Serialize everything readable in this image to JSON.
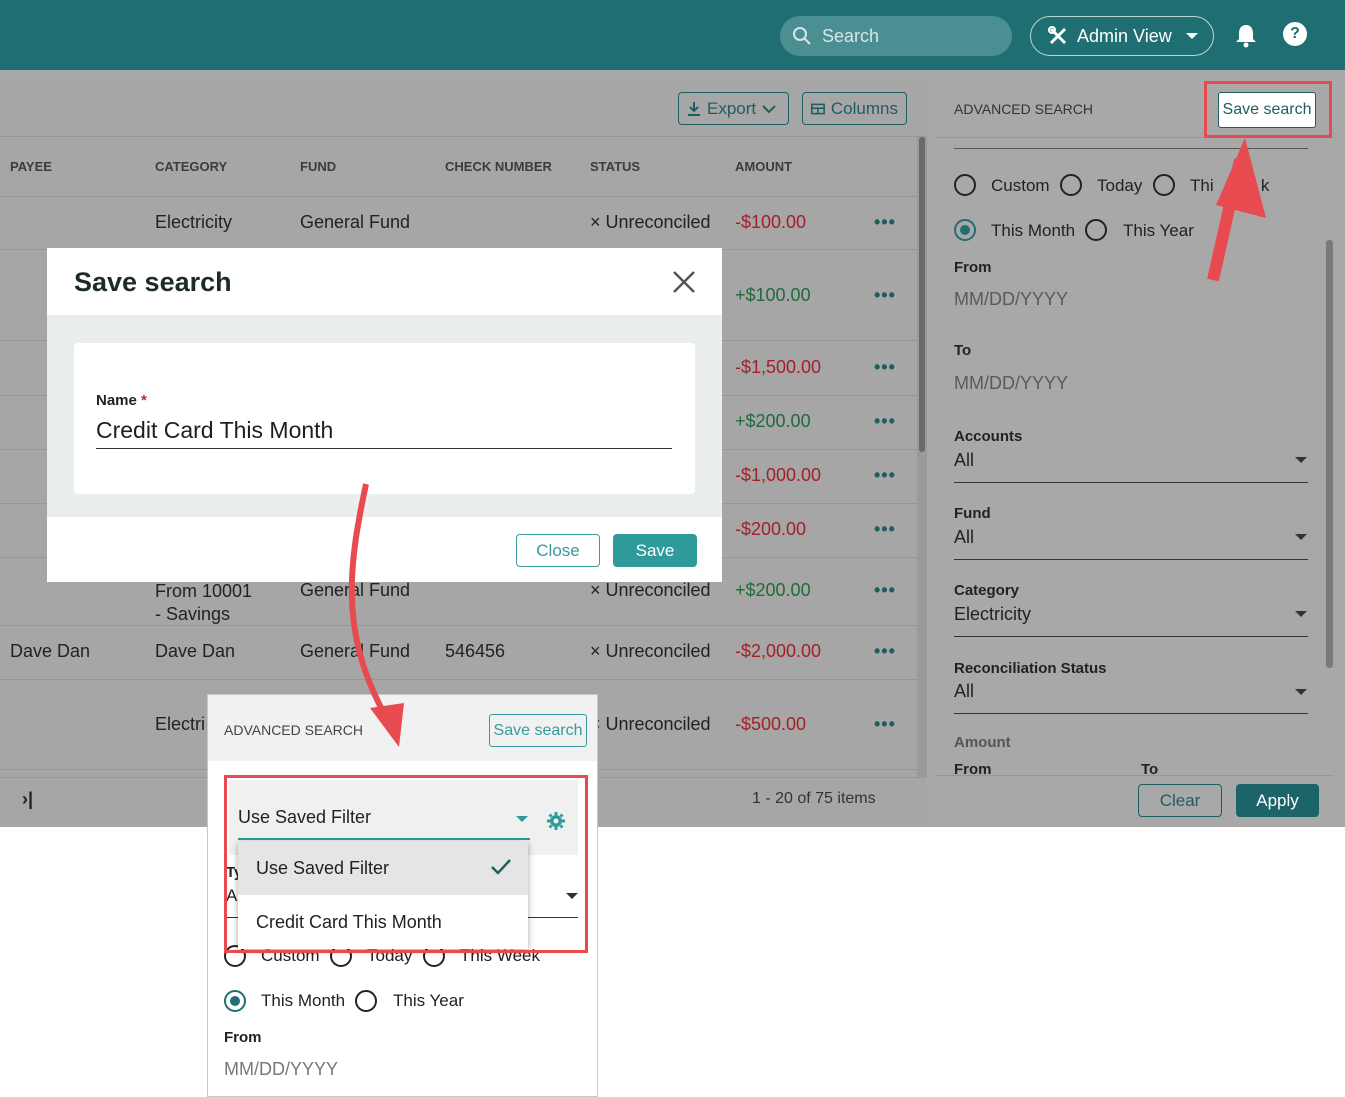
{
  "topbar": {
    "search_placeholder": "Search",
    "admin_label": "Admin View",
    "help_label": "?"
  },
  "toolbar": {
    "export_label": "Export",
    "columns_label": "Columns"
  },
  "table": {
    "headers": [
      "PAYEE",
      "CATEGORY",
      "FUND",
      "CHECK NUMBER",
      "STATUS",
      "AMOUNT"
    ],
    "rows": [
      {
        "payee": "",
        "category": "Electricity",
        "fund": "General Fund",
        "check": "",
        "status": "× Unreconciled",
        "amount": "-$100.00",
        "sign": "neg"
      },
      {
        "amount": "+$100.00",
        "sign": "pos"
      },
      {
        "amount": "-$1,500.00",
        "sign": "neg"
      },
      {
        "amount": "+$200.00",
        "sign": "pos"
      },
      {
        "amount": "-$1,000.00",
        "sign": "neg"
      },
      {
        "amount": "-$200.00",
        "sign": "neg"
      },
      {
        "payee": "",
        "category": "From 10001 - Savings",
        "category_line1": "From 10001",
        "category_line2": "- Savings",
        "fund": "General Fund",
        "check": "",
        "status": "× Unreconciled",
        "amount": "+$200.00",
        "sign": "pos"
      },
      {
        "payee": "Dave Dan",
        "category": "Dave Dan",
        "fund": "General Fund",
        "check": "546456",
        "status": "× Unreconciled",
        "amount": "-$2,000.00",
        "sign": "neg"
      },
      {
        "payee": "",
        "category": "Electri",
        "fund": "",
        "check": "",
        "status": "× Unreconciled",
        "amount": "-$500.00",
        "sign": "neg"
      }
    ],
    "row_action": "•••",
    "pager_last": "›|",
    "pager_info": "1 - 20 of 75 items"
  },
  "advanced_search": {
    "title": "ADVANCED SEARCH",
    "save_search_label": "Save search",
    "radio_options": [
      "Custom",
      "Today",
      "This Week",
      "This Month",
      "This Year"
    ],
    "radio_visible_partial": "Thi          k",
    "selected_period": "This Month",
    "from_label": "From",
    "from_placeholder": "MM/DD/YYYY",
    "to_label": "To",
    "to_placeholder": "MM/DD/YYYY",
    "accounts_label": "Accounts",
    "accounts_value": "All",
    "fund_label": "Fund",
    "fund_value": "All",
    "category_label": "Category",
    "category_value": "Electricity",
    "reconciliation_label": "Reconciliation Status",
    "reconciliation_value": "All",
    "amount_label": "Amount",
    "amount_from_label": "From",
    "amount_to_label": "To",
    "clear_label": "Clear",
    "apply_label": "Apply"
  },
  "modal": {
    "title": "Save search",
    "name_label": "Name",
    "required_mark": "*",
    "name_value": "Credit Card This Month",
    "close_label": "Close",
    "save_label": "Save"
  },
  "inset": {
    "title": "ADVANCED SEARCH",
    "save_search_label": "Save search",
    "saved_filter_value": "Use Saved Filter",
    "dropdown_options": [
      "Use Saved Filter",
      "Credit Card This Month"
    ],
    "selected_option": "Use Saved Filter",
    "type_partial": "Ty",
    "type_value_partial": "A",
    "radio_options_partial": [
      "Custom",
      "Today",
      "This Week"
    ],
    "this_month_label": "This Month",
    "this_year_label": "This Year",
    "from_label": "From",
    "from_placeholder": "MM/DD/YYYY"
  },
  "colors": {
    "topbar": "#1e6e72",
    "accent": "#2f9a9c",
    "highlight": "#e84b4f",
    "negative": "#a3202a",
    "positive": "#1f6b3a"
  }
}
